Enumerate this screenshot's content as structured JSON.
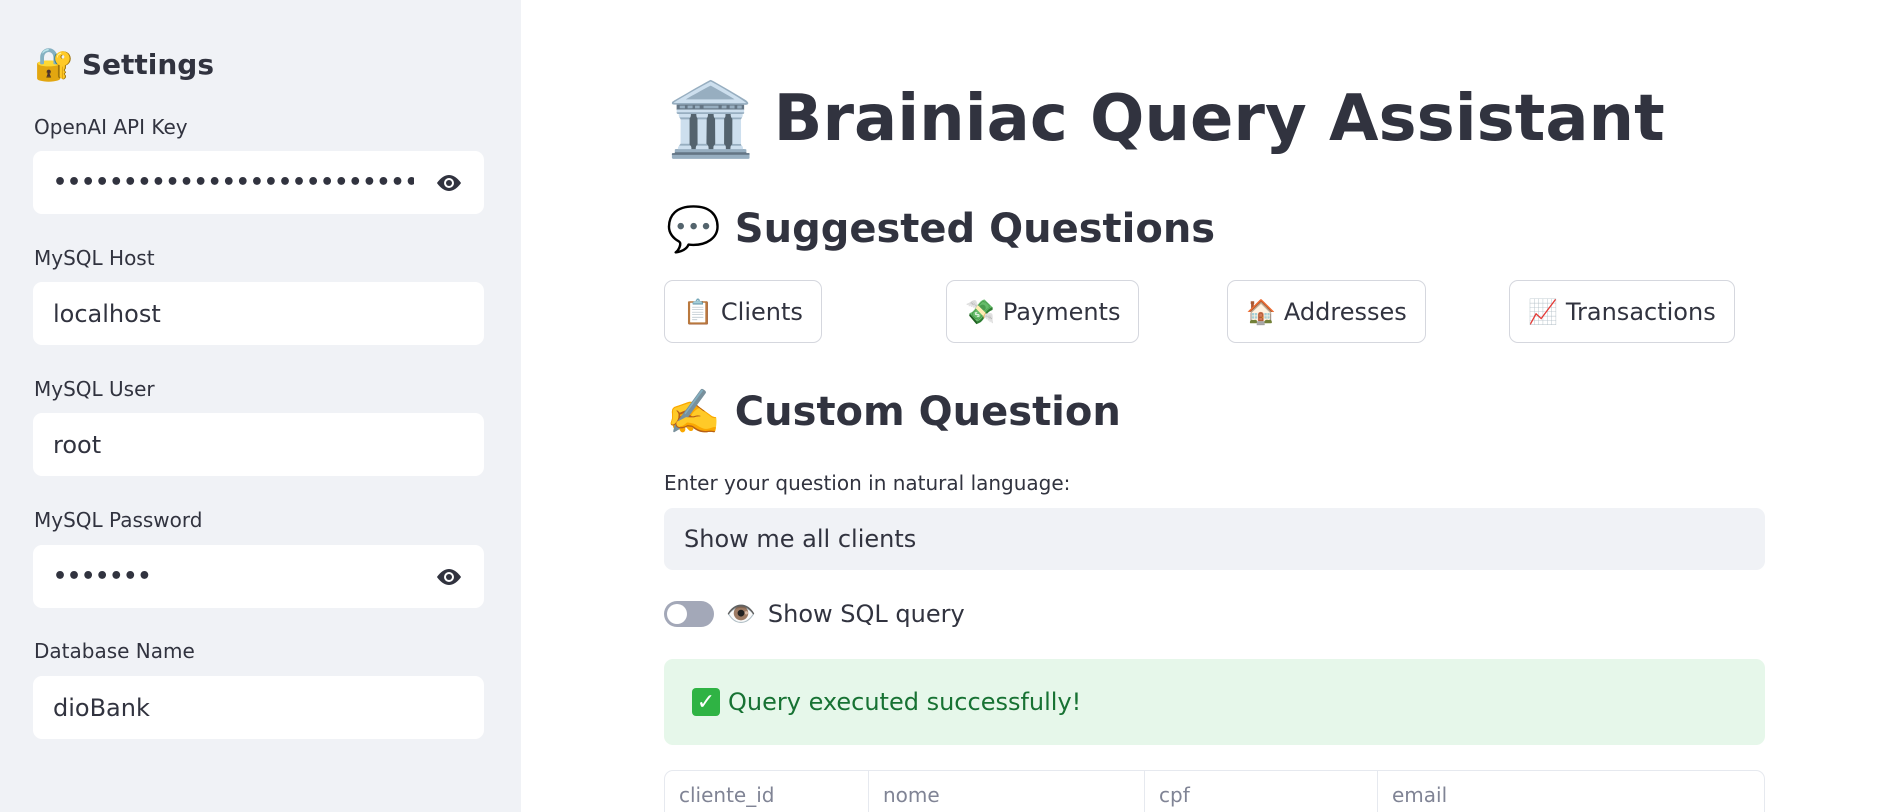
{
  "sidebar": {
    "title": "Settings",
    "title_icon": "🔐",
    "fields": [
      {
        "label": "OpenAI API Key",
        "value": "••••••••••••••••••••••••••••••••••••••••••••••••",
        "type": "password"
      },
      {
        "label": "MySQL Host",
        "value": "localhost",
        "type": "text"
      },
      {
        "label": "MySQL User",
        "value": "root",
        "type": "text"
      },
      {
        "label": "MySQL Password",
        "value": "•••••••",
        "type": "password"
      },
      {
        "label": "Database Name",
        "value": "dioBank",
        "type": "text"
      }
    ]
  },
  "main": {
    "title": "Brainiac Query Assistant",
    "title_icon": "🏛️",
    "suggested": {
      "heading": "Suggested Questions",
      "icon": "💬",
      "buttons": [
        {
          "icon": "📋",
          "label": "Clients"
        },
        {
          "icon": "💸",
          "label": "Payments"
        },
        {
          "icon": "🏠",
          "label": "Addresses"
        },
        {
          "icon": "📈",
          "label": "Transactions"
        }
      ]
    },
    "custom": {
      "heading": "Custom Question",
      "icon": "✍️",
      "input_label": "Enter your question in natural language:",
      "input_value": "Show me all clients"
    },
    "toggle": {
      "icon": "👁️",
      "label": "Show SQL query",
      "checked": false
    },
    "success": {
      "icon": "✓",
      "message": "Query executed successfully!"
    },
    "table": {
      "columns": [
        "cliente_id",
        "nome",
        "cpf",
        "email"
      ]
    }
  },
  "colors": {
    "sidebar_bg": "#f0f2f6",
    "text": "#31333f",
    "success_bg": "#e6f7ea",
    "success_text": "#177233",
    "check_green": "#2fb344"
  }
}
